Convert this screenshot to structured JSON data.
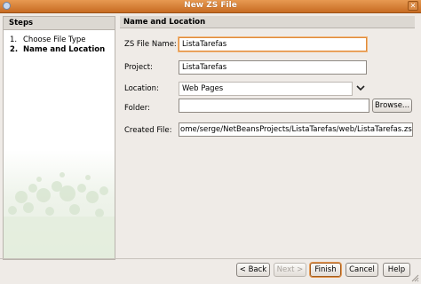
{
  "window": {
    "title": "New ZS File"
  },
  "steps": {
    "header": "Steps",
    "items": [
      {
        "num": "1.",
        "label": "Choose File Type"
      },
      {
        "num": "2.",
        "label": "Name and Location"
      }
    ]
  },
  "panel": {
    "header": "Name and Location",
    "file_name_label": "ZS File Name:",
    "file_name_value": "ListaTarefas",
    "project_label": "Project:",
    "project_value": "ListaTarefas",
    "location_label": "Location:",
    "location_value": "Web Pages",
    "folder_label": "Folder:",
    "folder_value": "",
    "browse_label": "Browse...",
    "created_file_label": "Created File:",
    "created_file_value": "ome/serge/NetBeansProjects/ListaTarefas/web/ListaTarefas.zs"
  },
  "buttons": {
    "back": "< Back",
    "next": "Next >",
    "finish": "Finish",
    "cancel": "Cancel",
    "help": "Help"
  }
}
